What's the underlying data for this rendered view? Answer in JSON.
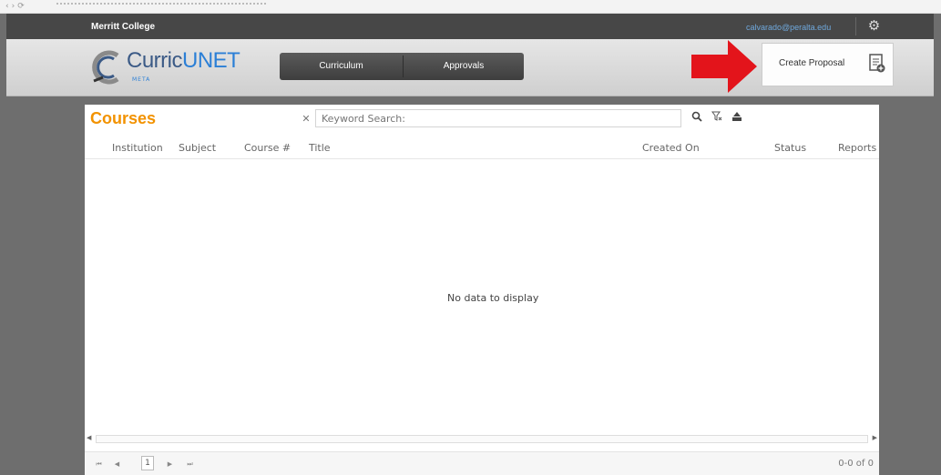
{
  "topbar": {
    "college": "Merritt College",
    "user_email": "calvarado@peralta.edu"
  },
  "header": {
    "logo_part1": "Curric",
    "logo_part2": "UNET",
    "logo_sub": "META",
    "nav": [
      "Curriculum",
      "Approvals"
    ],
    "create_proposal": "Create Proposal"
  },
  "courses": {
    "title": "Courses",
    "search_placeholder": "Keyword Search:",
    "columns": [
      "Institution",
      "Subject",
      "Course #",
      "Title",
      "Created On",
      "Status",
      "Reports"
    ],
    "empty_message": "No data to display",
    "pager": {
      "current_page": "1",
      "count": "0-0 of 0"
    }
  },
  "colors": {
    "accent": "#f29200",
    "topbar": "#474747",
    "arrow": "#e3141b",
    "link": "#6fa8dc"
  },
  "icons": [
    "gear-icon",
    "arrow-icon",
    "proposal-icon",
    "clear-search-icon",
    "search-icon",
    "clear-filter-icon",
    "export-icon",
    "first-page-icon",
    "prev-page-icon",
    "next-page-icon",
    "last-page-icon"
  ]
}
